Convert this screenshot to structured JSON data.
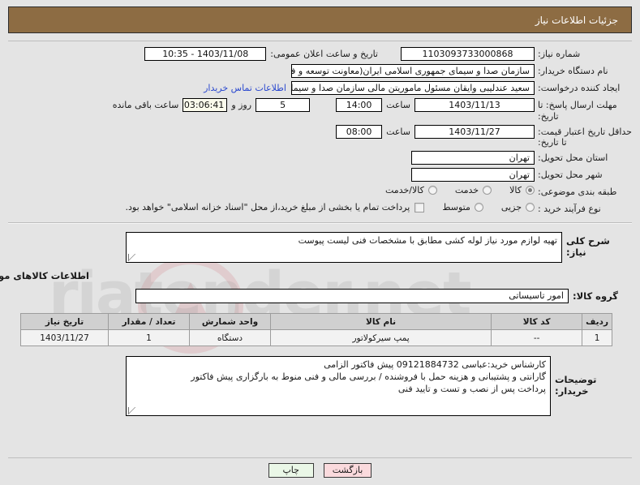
{
  "header": {
    "title": "جزئیات اطلاعات نیاز"
  },
  "watermark": {
    "text": "riatender.net",
    "logo_icon": "circle-a-logo"
  },
  "form": {
    "need_number": {
      "label": "شماره نیاز:",
      "value": "1103093733000868"
    },
    "public_announce": {
      "label": "تاریخ و ساعت اعلان عمومی:",
      "value": "1403/11/08 - 10:35"
    },
    "buyer_org": {
      "label": "نام دستگاه خریدار:",
      "value": "سازمان صدا و سیمای جمهوری اسلامی ایران(معاونت توسعه و فناور"
    },
    "requester": {
      "label": "ایجاد کننده درخواست:",
      "value": "سعید عندلیبی وایقان مسئول ماموریتن مالی  سازمان صدا و سیمای جمهوری اس",
      "contact_link": "اطلاعات تماس خریدار"
    },
    "response_deadline": {
      "label": "مهلت ارسال پاسخ: تا تاریخ:",
      "date": "1403/11/13",
      "time_label": "ساعت",
      "time": "14:00",
      "days": "5",
      "days_label": "روز و",
      "countdown": "03:06:41",
      "countdown_label": "ساعت باقی مانده"
    },
    "price_validity": {
      "label": "حداقل تاریخ اعتبار قیمت: تا تاریخ:",
      "date": "1403/11/27",
      "time_label": "ساعت",
      "time": "08:00"
    },
    "province": {
      "label": "استان محل تحویل:",
      "value": "تهران"
    },
    "city": {
      "label": "شهر محل تحویل:",
      "value": "تهران"
    },
    "subject_class": {
      "label": "طبقه بندی موضوعی:",
      "options": [
        "کالا",
        "خدمت",
        "کالا/خدمت"
      ],
      "selected": "کالا"
    },
    "purchase_process": {
      "label": "نوع فرآیند خرید :",
      "options": [
        "جزیی",
        "متوسط"
      ],
      "selected": "",
      "checkbox_label": "پرداخت تمام یا بخشی از مبلغ خرید،از محل \"اسناد خزانه اسلامی\" خواهد بود.",
      "checkbox_checked": false
    }
  },
  "description": {
    "label": "شرح کلی نیاز:",
    "value": "تهیه لوازم مورد نیاز لوله کشی مطابق با مشخصات فنی لیست پیوست"
  },
  "goods_section": {
    "title": "اطلاعات کالاهای مورد نیاز",
    "group": {
      "label": "گروه کالا:",
      "value": "امور تاسیساتی"
    },
    "table": {
      "columns": [
        "ردیف",
        "کد کالا",
        "نام کالا",
        "واحد شمارش",
        "تعداد / مقدار",
        "تاریخ نیاز"
      ],
      "rows": [
        {
          "row_no": "1",
          "code": "--",
          "name": "پمپ سیرکولاتور",
          "unit": "دستگاه",
          "qty": "1",
          "need_date": "1403/11/27"
        }
      ]
    }
  },
  "buyer_notes": {
    "label": "توضیحات خریدار:",
    "lines": [
      "کارشناس خرید:عباسی 09121884732  پیش فاکتور الزامی",
      "گارانتی و پشتیبانی و هزینه حمل با فروشنده / بررسی مالی و فنی منوط به بارگزاری پیش فاکتور",
      "پرداخت پس از نصب و تست و تایید فنی"
    ]
  },
  "buttons": {
    "print": "چاپ",
    "back": "بازگشت"
  }
}
